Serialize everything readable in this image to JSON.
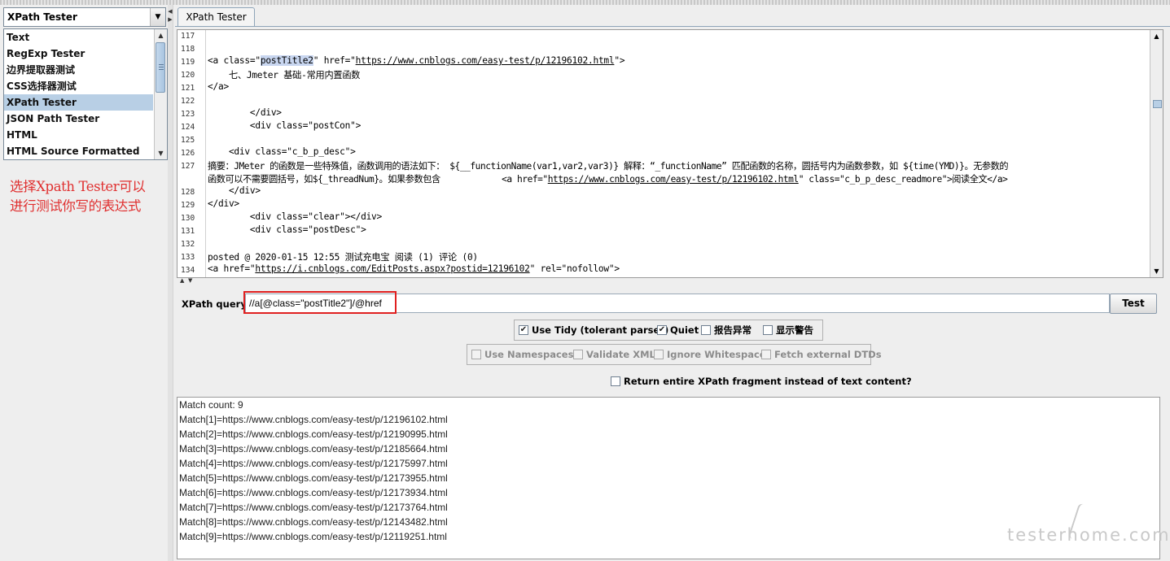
{
  "sampler_combo": {
    "value": "XPath Tester"
  },
  "renderer_list": [
    {
      "label": "Text"
    },
    {
      "label": "RegExp Tester"
    },
    {
      "label": "边界提取器测试"
    },
    {
      "label": "CSS选择器测试"
    },
    {
      "label": "XPath Tester",
      "selected": true
    },
    {
      "label": "JSON Path Tester"
    },
    {
      "label": "HTML"
    },
    {
      "label": "HTML Source Formatted"
    }
  ],
  "annotation": {
    "line1": "选择Xpath Tester可以",
    "line2": "进行测试你写的表达式",
    "color": "#e03030"
  },
  "tab": {
    "label": "XPath Tester"
  },
  "editor": {
    "line_numbers": [
      "117",
      "118",
      "119",
      "120",
      "121",
      "122",
      "123",
      "124",
      "125",
      "126",
      "127",
      "128",
      "129",
      "130",
      "131",
      "132",
      "133",
      "134"
    ],
    "lines": {
      "l119_pre": "<a class=\"",
      "l119_hl": "postTitle2",
      "l119_mid": "\" href=\"",
      "l119_link": "https://www.cnblogs.com/easy-test/p/12196102.html",
      "l119_post": "\">",
      "l120": "    七、Jmeter 基础-常用内置函数",
      "l121": "</a>",
      "l123": "        </div>",
      "l124": "        <div class=\"postCon\">",
      "l126": "    <div class=\"c_b_p_desc\">",
      "l127a": "摘要：JMeter 的函数是一些特殊值，函数调用的语法如下： ${__functionName(var1,var2,var3)} 解释：“_functionName” 匹配函数的名称，圆括号内为函数参数，如 ${time(YMD)}。无参数的",
      "l127b_pre": "函数可以不需要圆括号，如${_threadNum}。如果参数包含            <a href=\"",
      "l127b_link": "https://www.cnblogs.com/easy-test/p/12196102.html",
      "l127b_post": "\" class=\"c_b_p_desc_readmore\">阅读全文</a>",
      "l128": "    </div>",
      "l129": "</div>",
      "l130": "        <div class=\"clear\"></div>",
      "l131": "        <div class=\"postDesc\">",
      "l133": "posted @ 2020-01-15 12:55 测试充电宝 阅读 (1) 评论 (0)",
      "l134_pre": "<a href=\"",
      "l134_link": "https://i.cnblogs.com/EditPosts.aspx?postid=12196102",
      "l134_post": "\" rel=\"nofollow\">"
    }
  },
  "xpath_query": {
    "label": "XPath query :",
    "value": "//a[@class=\"postTitle2\"]/@href",
    "test_button": "Test",
    "highlight_color": "#e02020"
  },
  "options_row1": [
    {
      "label": "Use Tidy (tolerant parser)",
      "checked": true,
      "mark": "✔"
    },
    {
      "label": "Quiet",
      "checked": true,
      "mark": "✔"
    },
    {
      "label": "报告异常",
      "checked": false
    },
    {
      "label": "显示警告",
      "checked": false
    }
  ],
  "options_row2": [
    {
      "label": "Use Namespaces",
      "enabled": false
    },
    {
      "label": "Validate XML",
      "enabled": false
    },
    {
      "label": "Ignore Whitespace",
      "enabled": false
    },
    {
      "label": "Fetch external DTDs",
      "enabled": false
    }
  ],
  "fragment_option": {
    "label": "Return entire XPath fragment instead of text content?",
    "checked": false
  },
  "results": [
    "Match count: 9",
    "Match[1]=https://www.cnblogs.com/easy-test/p/12196102.html",
    "Match[2]=https://www.cnblogs.com/easy-test/p/12190995.html",
    "Match[3]=https://www.cnblogs.com/easy-test/p/12185664.html",
    "Match[4]=https://www.cnblogs.com/easy-test/p/12175997.html",
    "Match[5]=https://www.cnblogs.com/easy-test/p/12173955.html",
    "Match[6]=https://www.cnblogs.com/easy-test/p/12173934.html",
    "Match[7]=https://www.cnblogs.com/easy-test/p/12173764.html",
    "Match[8]=https://www.cnblogs.com/easy-test/p/12143482.html",
    "Match[9]=https://www.cnblogs.com/easy-test/p/12119251.html"
  ],
  "watermark": "testerhome.com"
}
